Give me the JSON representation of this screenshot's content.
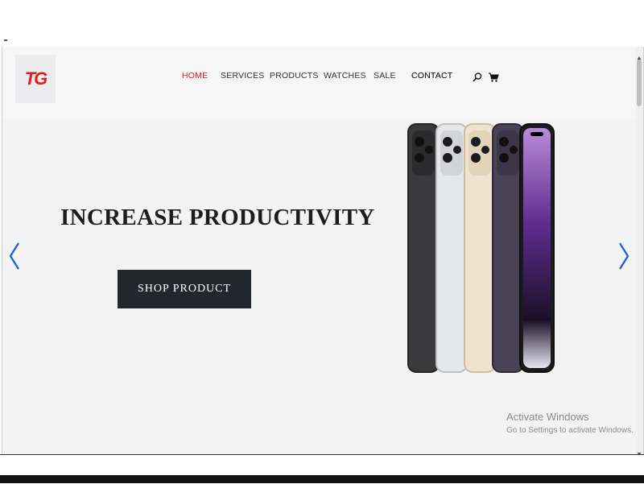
{
  "logo": {
    "text": "TG"
  },
  "nav": {
    "items": [
      {
        "label": "HOME"
      },
      {
        "label": "SERVICES"
      },
      {
        "label": "PRODUCTS"
      },
      {
        "label": "WATCHES"
      },
      {
        "label": "SALE"
      },
      {
        "label": "CONTACT"
      }
    ],
    "icons": [
      "search-icon",
      "cart-icon"
    ]
  },
  "hero": {
    "headline": "INCREASE PRODUCTIVITY",
    "button_label": "SHOP PRODUCT",
    "image": "phone-lineup-image"
  },
  "watermark": {
    "title": "Activate Windows",
    "subtitle": "Go to Settings to activate Windows."
  },
  "colors": {
    "accent": "#e01d1d",
    "button_bg": "#23262b",
    "arrow": "#1a5fd1"
  }
}
